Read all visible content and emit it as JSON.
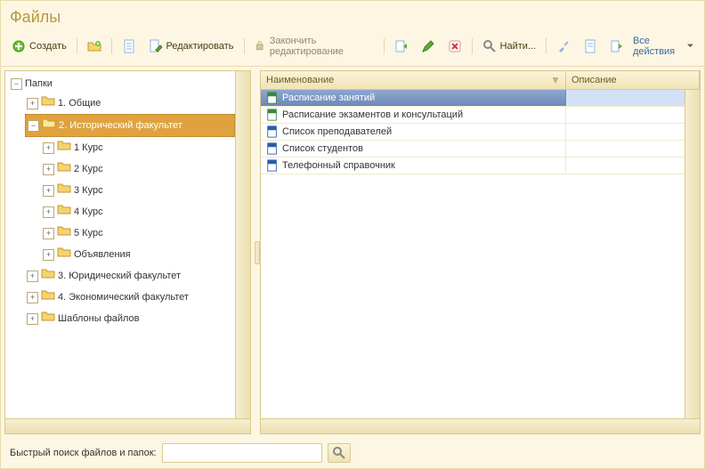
{
  "title": "Файлы",
  "toolbar": {
    "create": "Создать",
    "edit": "Редактировать",
    "finish_edit": "Закончить редактирование",
    "find": "Найти...",
    "all_actions": "Все действия"
  },
  "tree": {
    "root": "Папки",
    "items": [
      {
        "label": "1. Общие",
        "children": [],
        "expanded": false
      },
      {
        "label": "2. Исторический факультет",
        "selected": true,
        "expanded": true,
        "children": [
          {
            "label": "1 Курс"
          },
          {
            "label": "2 Курс"
          },
          {
            "label": "3 Курс"
          },
          {
            "label": "4 Курс"
          },
          {
            "label": "5 Курс"
          },
          {
            "label": "Объявления"
          }
        ]
      },
      {
        "label": "3. Юридический факультет",
        "children": [],
        "expanded": false
      },
      {
        "label": "4. Экономический факультет",
        "children": [],
        "expanded": false
      },
      {
        "label": "Шаблоны файлов",
        "children": [],
        "expanded": false
      }
    ]
  },
  "grid": {
    "col_name": "Наименование",
    "col_desc": "Описание",
    "rows": [
      {
        "name": "Расписание занятий",
        "type": "xls",
        "selected": true
      },
      {
        "name": "Расписание экзаментов и консультаций",
        "type": "xls"
      },
      {
        "name": "Список преподавателей",
        "type": "doc"
      },
      {
        "name": "Список студентов",
        "type": "doc"
      },
      {
        "name": "Телефонный справочник",
        "type": "doc"
      }
    ]
  },
  "search": {
    "label": "Быстрый поиск файлов и папок:",
    "value": ""
  }
}
